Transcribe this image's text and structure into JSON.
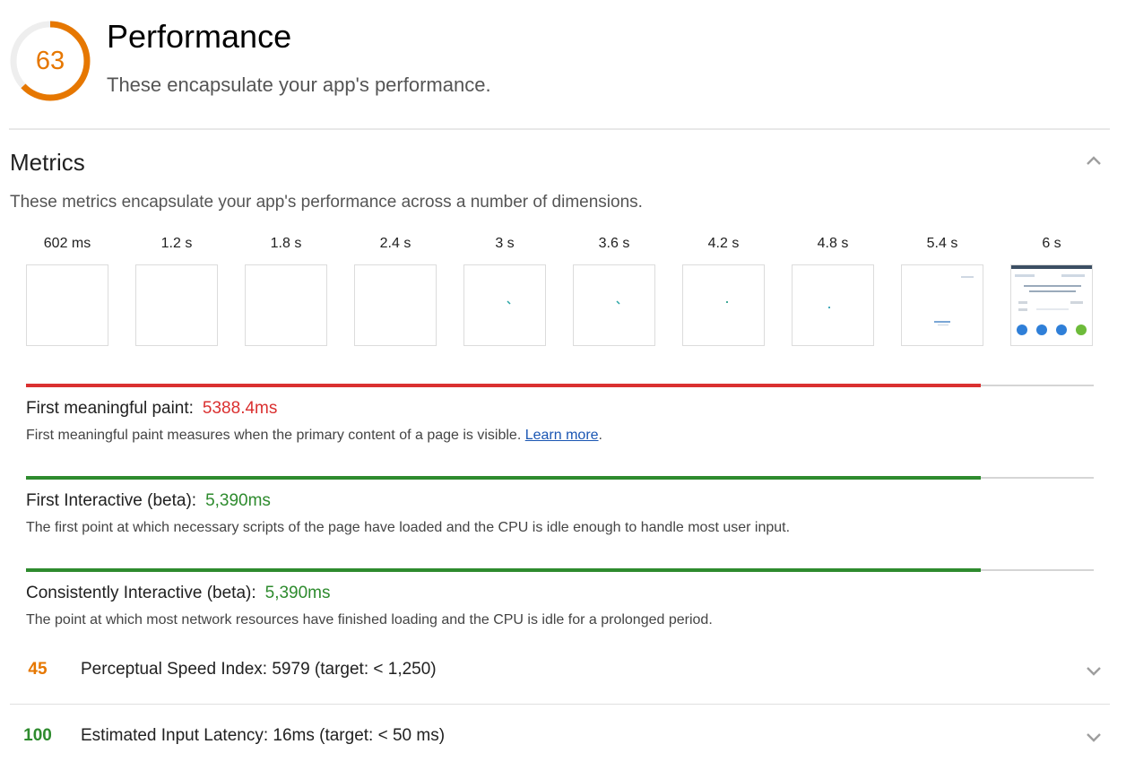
{
  "category": {
    "score": "63",
    "score_fraction": 0.63,
    "score_color": "#e67700",
    "title": "Performance",
    "description": "These encapsulate your app's performance."
  },
  "metrics_group": {
    "title": "Metrics",
    "description": "These metrics encapsulate your app's performance across a number of dimensions.",
    "collapse_icon": "chevron-up-icon"
  },
  "filmstrip": {
    "frames": [
      {
        "label": "602 ms"
      },
      {
        "label": "1.2 s"
      },
      {
        "label": "1.8 s"
      },
      {
        "label": "2.4 s"
      },
      {
        "label": "3 s"
      },
      {
        "label": "3.6 s"
      },
      {
        "label": "4.2 s"
      },
      {
        "label": "4.8 s"
      },
      {
        "label": "5.4 s"
      },
      {
        "label": "6 s"
      }
    ]
  },
  "metrics": [
    {
      "name": "First meaningful paint:",
      "value": "5388.4ms",
      "color": "#da3030",
      "bar_fraction": 0.894,
      "help": "First meaningful paint measures when the primary content of a page is visible. ",
      "link": "Learn more",
      "after_link": "."
    },
    {
      "name": "First Interactive (beta):",
      "value": "5,390ms",
      "color": "#2e8b2e",
      "bar_fraction": 0.894,
      "help": "The first point at which necessary scripts of the page have loaded and the CPU is idle enough to handle most user input."
    },
    {
      "name": "Consistently Interactive (beta):",
      "value": "5,390ms",
      "color": "#2e8b2e",
      "bar_fraction": 0.894,
      "help": "The point at which most network resources have finished loading and the CPU is idle for a prolonged period."
    }
  ],
  "audits": [
    {
      "score": "45",
      "color": "#e67700",
      "title": "Perceptual Speed Index: 5979 (target: < 1,250)",
      "icon": "chevron-down-icon"
    },
    {
      "score": "100",
      "color": "#2e8b2e",
      "title": "Estimated Input Latency: 16ms (target: < 50 ms)",
      "icon": "chevron-down-icon"
    }
  ]
}
